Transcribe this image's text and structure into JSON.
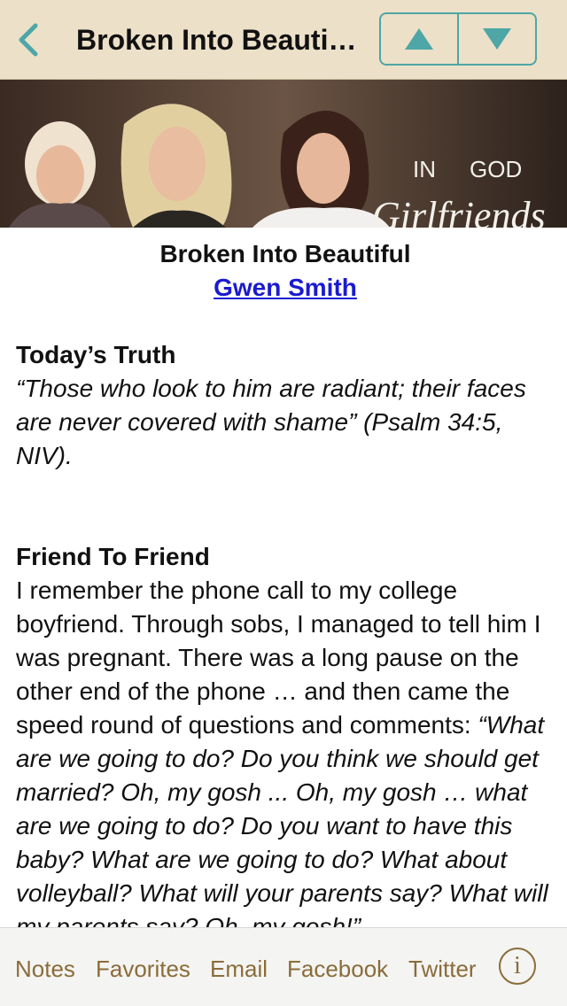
{
  "header": {
    "title": "Broken Into Beauti…",
    "back_icon": "chevron-left-icon",
    "prev_icon": "triangle-up-icon",
    "next_icon": "triangle-down-icon"
  },
  "banner": {
    "logo_script": "Girlfriends",
    "logo_in": "IN",
    "logo_god": "GOD"
  },
  "article": {
    "title": "Broken Into Beautiful",
    "author": "Gwen Smith",
    "truth_heading": "Today’s Truth",
    "truth_text": "“Those who look to him are radiant; their faces are never covered with shame” (Psalm 34:5, NIV).",
    "friend_heading": "Friend To Friend",
    "friend_text": "I remember the phone call to my college boyfriend. Through sobs, I managed to tell him I was pregnant. There was a long pause on the other end of the phone … and then came the speed round of questions and comments: ",
    "friend_quote": "“What are we going to do? Do you think we should get married? Oh, my gosh ... Oh, my gosh … what are we going to do? Do you want to have this baby? What are we going to do? What about volleyball? What will your parents say? What will my parents say? Oh, my gosh!”"
  },
  "toolbar": {
    "notes": "Notes",
    "favorites": "Favorites",
    "email": "Email",
    "facebook": "Facebook",
    "twitter": "Twitter",
    "info_glyph": "i"
  },
  "colors": {
    "nav_bg": "#ece0c8",
    "accent_teal": "#4ea6a6",
    "toolbar_text": "#8a6c3a",
    "link": "#1a1ad0"
  }
}
